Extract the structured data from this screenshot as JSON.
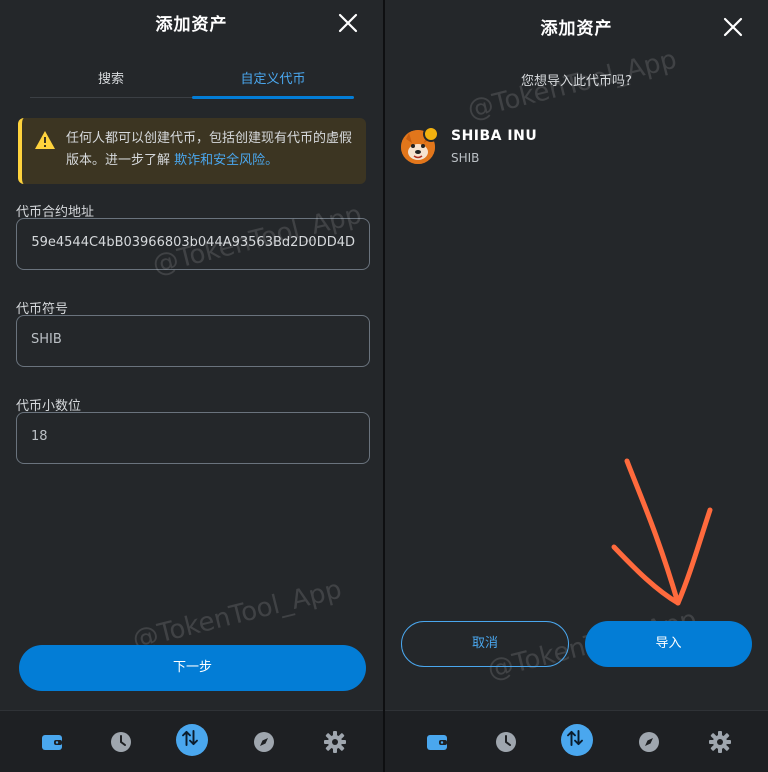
{
  "left": {
    "title": "添加资产",
    "tabs": [
      {
        "label": "搜索"
      },
      {
        "label": "自定义代币"
      }
    ],
    "warning": {
      "text": "任何人都可以创建代币，包括创建现有代币的虚假版本。进一步了解 ",
      "link": "欺诈和安全风险。"
    },
    "fields": {
      "address": {
        "label": "代币合约地址",
        "value": "59e4544C4bB03966803b044A93563Bd2D0DD4D"
      },
      "symbol": {
        "label": "代币符号",
        "value": "SHIB"
      },
      "decimals": {
        "label": "代币小数位",
        "value": "18"
      }
    },
    "next_button": "下一步"
  },
  "right": {
    "title": "添加资产",
    "question": "您想导入此代币吗?",
    "token": {
      "name": "SHIBA INU",
      "symbol": "SHIB"
    },
    "cancel_button": "取消",
    "import_button": "导入"
  },
  "navbar": [
    {
      "icon": "wallet-icon"
    },
    {
      "icon": "clock-icon"
    },
    {
      "icon": "swap-icon",
      "active": true
    },
    {
      "icon": "compass-icon"
    },
    {
      "icon": "gear-icon"
    }
  ],
  "watermark": "@TokenTool_App",
  "colors": {
    "accent": "#037dd6",
    "link": "#4aa7ee",
    "warning": "#ffd33d",
    "panel": "#24272a",
    "annotation_arrow": "#ff6a3d"
  }
}
